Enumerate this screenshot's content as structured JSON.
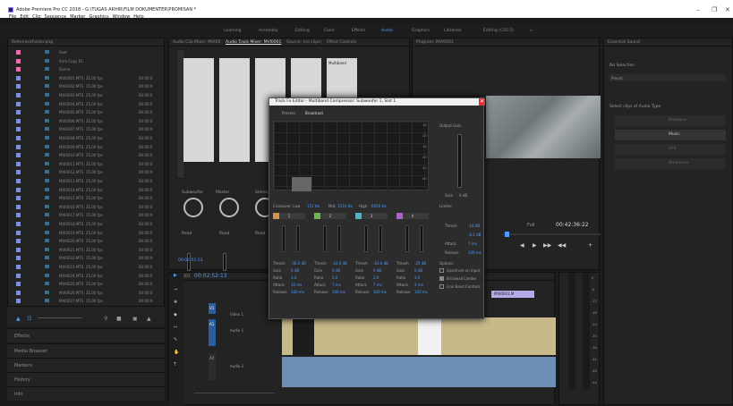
{
  "window": {
    "title": "Adobe Premiere Pro CC 2018 - G:\\TUGAS AKHIR\\FILM DOKUMENTER\\PROMISAN *",
    "menu": [
      "File",
      "Edit",
      "Clip",
      "Sequence",
      "Marker",
      "Graphics",
      "Window",
      "Help"
    ],
    "controls": {
      "minimize": "–",
      "restore": "❐",
      "close": "✕"
    }
  },
  "workspaces": {
    "items": [
      "Learning",
      "Assembly",
      "Editing",
      "Color",
      "Effects",
      "Audio",
      "Graphics",
      "Libraries",
      "Editing (CS5.5)"
    ],
    "active": "Audio",
    "more": "»"
  },
  "project": {
    "title": "ReferenceFolder.png",
    "rows": [
      {
        "name": "Aset",
        "fps": "",
        "tc": "",
        "color": "#e86fb3"
      },
      {
        "name": "Item Copy 01",
        "fps": "",
        "tc": "",
        "color": "#e86fb3"
      },
      {
        "name": "Scene",
        "fps": "",
        "tc": "",
        "color": "#e86fb3"
      },
      {
        "name": "MVI0001.MTS",
        "fps": "25,00 fps",
        "tc": "00:00:0",
        "color": "#7d8fd6"
      },
      {
        "name": "MVI0002.MTS",
        "fps": "25,00 fps",
        "tc": "00:00:0",
        "color": "#7d8fd6"
      },
      {
        "name": "MVI0003.MTS",
        "fps": "25,00 fps",
        "tc": "00:00:0",
        "color": "#7d8fd6"
      },
      {
        "name": "MVI0004.MTS",
        "fps": "25,00 fps",
        "tc": "00:00:0",
        "color": "#7d8fd6"
      },
      {
        "name": "MVI0005.MTS",
        "fps": "25,00 fps",
        "tc": "00:00:0",
        "color": "#7d8fd6"
      },
      {
        "name": "MVI0006.MTS",
        "fps": "25,00 fps",
        "tc": "00:00:0",
        "color": "#7d8fd6"
      },
      {
        "name": "MVI0007.MTS",
        "fps": "25,00 fps",
        "tc": "00:00:0",
        "color": "#7d8fd6"
      },
      {
        "name": "MVI0008.MTS",
        "fps": "25,00 fps",
        "tc": "00:00:0",
        "color": "#7d8fd6"
      },
      {
        "name": "MVI0009.MTS",
        "fps": "25,00 fps",
        "tc": "00:00:0",
        "color": "#7d8fd6"
      },
      {
        "name": "MVI0010.MTS",
        "fps": "25,00 fps",
        "tc": "00:00:0",
        "color": "#7d8fd6"
      },
      {
        "name": "MVI0011.MTS",
        "fps": "25,00 fps",
        "tc": "00:00:0",
        "color": "#7d8fd6"
      },
      {
        "name": "MVI0012.MTS",
        "fps": "25,00 fps",
        "tc": "00:00:0",
        "color": "#7d8fd6"
      },
      {
        "name": "MVI0013.MTS",
        "fps": "25,00 fps",
        "tc": "00:00:0",
        "color": "#7d8fd6"
      },
      {
        "name": "MVI0014.MTS",
        "fps": "25,00 fps",
        "tc": "00:00:0",
        "color": "#7d8fd6"
      },
      {
        "name": "MVI0015.MTS",
        "fps": "25,00 fps",
        "tc": "00:00:0",
        "color": "#7d8fd6"
      },
      {
        "name": "MVI0016.MTS",
        "fps": "25,00 fps",
        "tc": "00:00:0",
        "color": "#7d8fd6"
      },
      {
        "name": "MVI0017.MTS",
        "fps": "25,00 fps",
        "tc": "00:00:0",
        "color": "#7d8fd6"
      },
      {
        "name": "MVI0018.MTS",
        "fps": "25,00 fps",
        "tc": "00:00:0",
        "color": "#7d8fd6"
      },
      {
        "name": "MVI0019.MTS",
        "fps": "25,00 fps",
        "tc": "00:00:0",
        "color": "#7d8fd6"
      },
      {
        "name": "MVI0020.MTS",
        "fps": "25,00 fps",
        "tc": "00:00:0",
        "color": "#7d8fd6"
      },
      {
        "name": "MVI0021.MTS",
        "fps": "25,00 fps",
        "tc": "00:00:0",
        "color": "#7d8fd6"
      },
      {
        "name": "MVI0022.MTS",
        "fps": "25,00 fps",
        "tc": "00:00:0",
        "color": "#7d8fd6"
      },
      {
        "name": "MVI0023.MTS",
        "fps": "25,00 fps",
        "tc": "00:00:0",
        "color": "#7d8fd6"
      },
      {
        "name": "MVI0024.MTS",
        "fps": "25,00 fps",
        "tc": "00:00:0",
        "color": "#7d8fd6"
      },
      {
        "name": "MVI0025.MTS",
        "fps": "25,00 fps",
        "tc": "00:00:0",
        "color": "#7d8fd6"
      },
      {
        "name": "MVI0026.MTS",
        "fps": "25,00 fps",
        "tc": "00:00:0",
        "color": "#7d8fd6"
      },
      {
        "name": "MVI0027.MTS",
        "fps": "25,00 fps",
        "tc": "00:00:0",
        "color": "#7d8fd6"
      }
    ]
  },
  "lower_panels": [
    "Effects",
    "Media Browser",
    "Markers",
    "History",
    "Info",
    "Libraries"
  ],
  "mixer": {
    "tabs": [
      "Audio Clip Mixer: MVI00",
      "Audio Track Mixer: MVI0001",
      "Source: (no clips)",
      "Effect Controls"
    ],
    "active_tab": "Audio Track Mixer: MVI0001",
    "insert_label": "Multiband",
    "channels": [
      "Subwoofer",
      "Master",
      "Stereo"
    ],
    "read_labels": [
      "Read",
      "Read",
      "Read"
    ],
    "timecode": "00:02:52:13"
  },
  "program": {
    "title": "Program: MVI0001",
    "timecode": "00:42:36:22",
    "fit": "Full",
    "controls": [
      "◀",
      "▶",
      "▶▶",
      "◀◀",
      "+"
    ]
  },
  "essential": {
    "title": "Essential Sound",
    "selection": "No Selection",
    "preset_label": "Preset",
    "edit_label": "Select clips of Audio Type",
    "types": [
      "Dialogue",
      "Music",
      "SFX",
      "Ambience"
    ]
  },
  "timeline": {
    "title": "MVI0001",
    "timecode": "00:02:52:13",
    "ruler": [
      "00:00:45:00",
      "00:01:00:00"
    ],
    "tracks": [
      "V1",
      "A1",
      "A2"
    ],
    "track_labels": {
      "video": "Video 1",
      "audio1": "Audio 1",
      "audio2": "Audio 2"
    },
    "clip_label": "MVI0001.M"
  },
  "fx": {
    "title": "Track Fx Editor - Multiband Compressor: Subwoofer 1, Slot 1",
    "presets_label": "Presets:",
    "preset_value": "Broadcast",
    "output_gain": "Output Gain",
    "crossover": {
      "low_label": "Crossover: Low",
      "low": "151 Hz",
      "mid_label": "Mid:",
      "mid": "1510 Hz",
      "high_label": "High:",
      "high": "6950 Hz"
    },
    "gain_label": "Gain",
    "gain_value": "0 dB",
    "bands": [
      {
        "id": "1",
        "color": "#d2934a",
        "thresh": "-36.0 dB",
        "gain": "0 dB",
        "ratio": "3.0",
        "attack": "10 ms",
        "release": "100 ms"
      },
      {
        "id": "2",
        "color": "#71b34f",
        "thresh": "-24.0 dB",
        "gain": "0 dB",
        "ratio": "2.0",
        "attack": "7 ms",
        "release": "100 ms"
      },
      {
        "id": "3",
        "color": "#4bb4c9",
        "thresh": "-24.0 dB",
        "gain": "0 dB",
        "ratio": "2.0",
        "attack": "7 ms",
        "release": "100 ms"
      },
      {
        "id": "4",
        "color": "#b05fcf",
        "thresh": "-25 dB",
        "gain": "0 dB",
        "ratio": "3.0",
        "attack": "3 ms",
        "release": "100 ms"
      }
    ],
    "row_labels": {
      "thresh": "Thresh",
      "gain": "Gain",
      "ratio": "Ratio",
      "attack": "Attack",
      "release": "Release"
    },
    "limiter": {
      "title": "Limiter",
      "thresh": "-10 dB",
      "margin": "-0.1 dB",
      "attack": "7 ms",
      "release": "100 ms"
    },
    "options": {
      "title": "Options",
      "spectrum": "Spectrum on Input",
      "brickwall": "Brickwall Limiter",
      "link": "Link Band Controls"
    },
    "axis": [
      "-10",
      "-20",
      "-30",
      "-40",
      "-50",
      "-60"
    ]
  },
  "meter": {
    "labels": [
      "0",
      "-6",
      "-12",
      "-18",
      "-24",
      "-30",
      "-36",
      "-42",
      "-48",
      "-54"
    ]
  }
}
